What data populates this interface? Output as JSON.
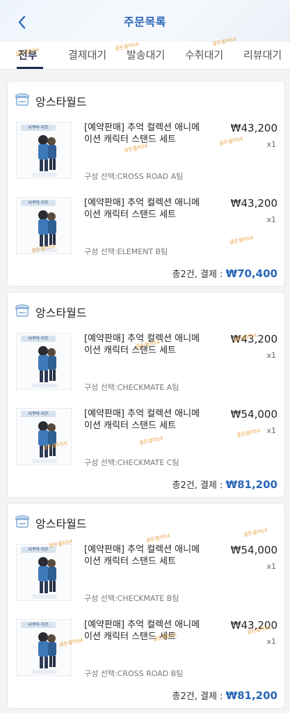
{
  "header": {
    "title": "주문목록",
    "back_icon": "chevron-left-icon"
  },
  "tabs": [
    {
      "label": "전부",
      "active": true
    },
    {
      "label": "결제대기",
      "active": false
    },
    {
      "label": "발송대기",
      "active": false
    },
    {
      "label": "수취대기",
      "active": false
    },
    {
      "label": "리뷰대기",
      "active": false
    }
  ],
  "watermark": "굴든셀러54",
  "orders": [
    {
      "store": "앙스타월드",
      "items": [
        {
          "name": "[예약판매] 추억 컬렉션 애니메이션 캐릭터 스탠드 세트",
          "price": "₩43,200",
          "qty": "x1",
          "option": "구성 선택:CROSS ROAD A팀",
          "thumb_title": "사쿠마 리츠"
        },
        {
          "name": "[예약판매] 추억 컬렉션 애니메이션 캐릭터 스탠드 세트",
          "price": "₩43,200",
          "qty": "x1",
          "option": "구성 선택:ELEMENT B팀",
          "thumb_title": "사쿠마 리츠"
        }
      ],
      "summary_prefix": "총2건, 결제 :",
      "summary_total": "₩70,400"
    },
    {
      "store": "앙스타월드",
      "items": [
        {
          "name": "[예약판매] 추억 컬렉션 애니메이션 캐릭터 스탠드 세트",
          "price": "₩43,200",
          "qty": "x1",
          "option": "구성 선택:CHECKMATE A팀",
          "thumb_title": "사쿠마 리츠"
        },
        {
          "name": "[예약판매] 추억 컬렉션 애니메이션 캐릭터 스탠드 세트",
          "price": "₩54,000",
          "qty": "x1",
          "option": "구성 선택:CHECKMATE C팀",
          "thumb_title": "사쿠마 리츠"
        }
      ],
      "summary_prefix": "총2건, 결제 :",
      "summary_total": "₩81,200"
    },
    {
      "store": "앙스타월드",
      "items": [
        {
          "name": "[예약판매] 추억 컬렉션 애니메이션 캐릭터 스탠드 세트",
          "price": "₩54,000",
          "qty": "x1",
          "option": "구성 선택:CHECKMATE B팀",
          "thumb_title": "사쿠마 리츠"
        },
        {
          "name": "[예약판매] 추억 컬렉션 애니메이션 캐릭터 스탠드 세트",
          "price": "₩43,200",
          "qty": "x1",
          "option": "구성 선택:CROSS ROAD B팀",
          "thumb_title": "사쿠마 리츠"
        }
      ],
      "summary_prefix": "총2건, 결제 :",
      "summary_total": "₩81,200"
    }
  ],
  "colors": {
    "accent": "#2a67b8",
    "tab_active": "#1c2b4a",
    "background": "#f3f4f6"
  }
}
